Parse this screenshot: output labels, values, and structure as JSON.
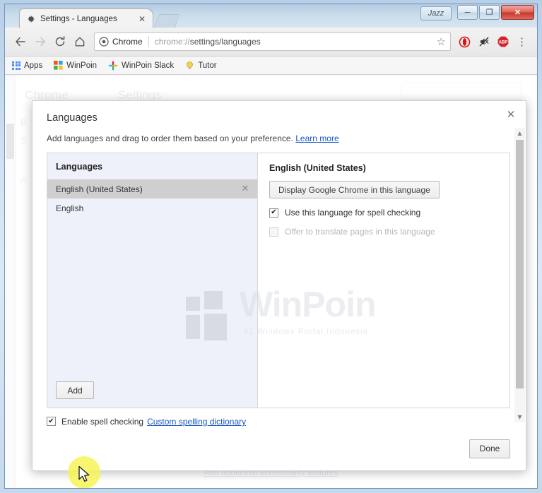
{
  "window": {
    "profile_label": "Jazz",
    "minimize_label": "─",
    "maximize_label": "❐",
    "close_label": "✕"
  },
  "tab": {
    "title": "Settings - Languages",
    "close_label": "✕",
    "favicon_name": "gear-icon"
  },
  "toolbar": {
    "back_label": "←",
    "forward_label": "→",
    "reload_label": "↻",
    "home_label": "⌂",
    "chip_label": "Chrome",
    "url_prefix": "chrome://",
    "url_bold": "settings/languages",
    "star_label": "☆",
    "menu_label": "⋮",
    "extensions": [
      "opera-icon",
      "mute-tab-icon",
      "adblock-plus-icon"
    ],
    "adblock_text": "ABP"
  },
  "bookmarks": [
    {
      "label": "Apps",
      "icon": "apps-grid-icon"
    },
    {
      "label": "WinPoin",
      "icon": "winpoin-icon"
    },
    {
      "label": "WinPoin Slack",
      "icon": "slack-icon"
    },
    {
      "label": "Tutor",
      "icon": "lightbulb-icon"
    }
  ],
  "background_page": {
    "brand": "Chrome",
    "section": "Settings",
    "side_item_1": "B",
    "side_item_2": "S",
    "side_item_3": "A",
    "bottom_link": "Add additional accessibility features"
  },
  "dialog": {
    "title": "Languages",
    "close_label": "✕",
    "description": "Add languages and drag to order them based on your preference.",
    "learn_more": "Learn more",
    "languages_pane": {
      "header": "Languages",
      "items": [
        {
          "label": "English (United States)",
          "selected": true,
          "remove_label": "✕"
        },
        {
          "label": "English",
          "selected": false,
          "remove_label": ""
        }
      ],
      "add_button": "Add"
    },
    "detail_pane": {
      "title": "English (United States)",
      "display_button": "Display Google Chrome in this language",
      "checkboxes": [
        {
          "label": "Use this language for spell checking",
          "checked": true,
          "disabled": false,
          "mark": "✔"
        },
        {
          "label": "Offer to translate pages in this language",
          "checked": false,
          "disabled": true,
          "mark": ""
        }
      ]
    },
    "footer": {
      "spellcheck_label": "Enable spell checking",
      "spellcheck_checked": true,
      "spellcheck_mark": "✔",
      "custom_dictionary_link": "Custom spelling dictionary",
      "done_button": "Done"
    },
    "scrollbar": {
      "up_arrow": "▲",
      "down_arrow": "▼"
    }
  },
  "watermark": {
    "text": "WinPoin",
    "tagline": "#1 Windows Portal Indonesia"
  },
  "colors": {
    "accent_blue": "#1a56c4",
    "pane_background": "#eef0fa",
    "selected_row": "#cfcfcf",
    "close_button_red": "#c23b2d",
    "highlight_yellow": "#f7f457"
  }
}
